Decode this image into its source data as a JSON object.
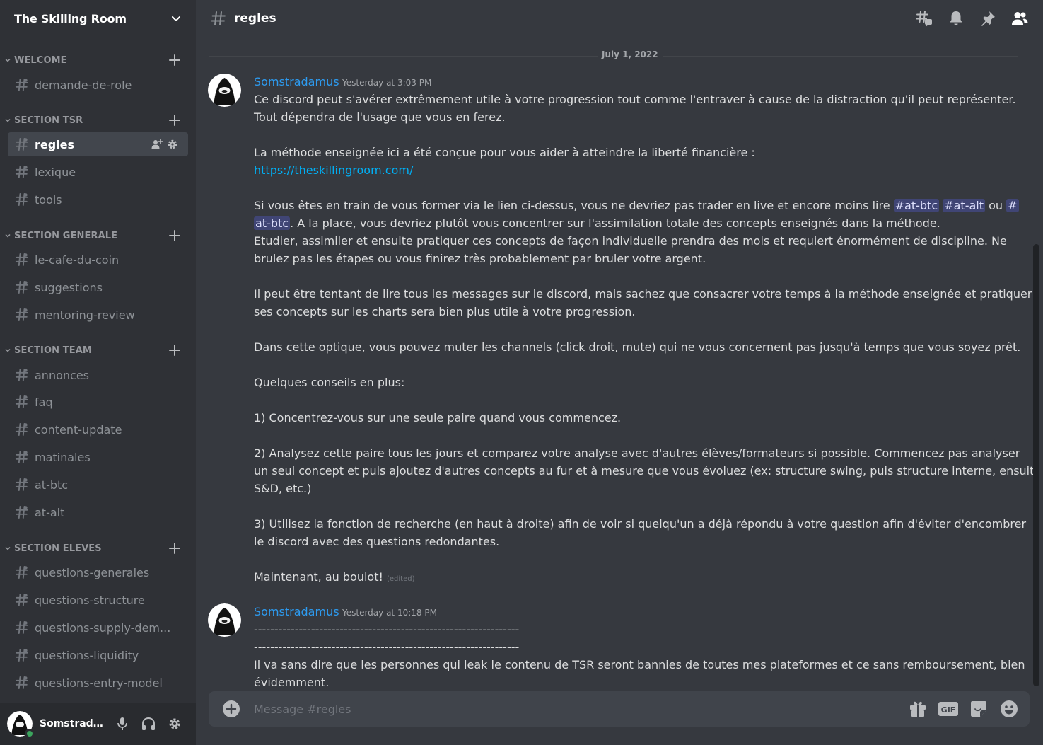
{
  "server": {
    "name": "The Skilling Room"
  },
  "categories": [
    {
      "label": "WELCOME",
      "channels": [
        "demande-de-role"
      ]
    },
    {
      "label": "SECTION TSR",
      "channels": [
        "regles",
        "lexique",
        "tools"
      ]
    },
    {
      "label": "SECTION GENERALE",
      "channels": [
        "le-cafe-du-coin",
        "suggestions",
        "mentoring-review"
      ]
    },
    {
      "label": "SECTION TEAM",
      "channels": [
        "annonces",
        "faq",
        "content-update",
        "matinales",
        "at-btc",
        "at-alt"
      ]
    },
    {
      "label": "SECTION ELEVES",
      "channels": [
        "questions-generales",
        "questions-structure",
        "questions-supply-dem...",
        "questions-liquidity",
        "questions-entry-model"
      ]
    }
  ],
  "active_channel": "regles",
  "user": {
    "name": "Somstrada...",
    "status": "online"
  },
  "header": {
    "channel_title": "regles",
    "icons": [
      "threads-icon",
      "bell-icon",
      "pin-icon",
      "members-icon"
    ]
  },
  "date_divider": "July 1, 2022",
  "messages": [
    {
      "author": "Somstradamus",
      "time": "Yesterday at 3:03 PM",
      "lines": {
        "l1": "Ce discord peut s'avérer extrêmement utile à votre progression tout comme l'entraver à cause de la distraction qu'il peut représenter.",
        "l2": "Tout dépendra de l'usage que vous en ferez.",
        "l3": "La méthode enseignée ici a été conçue pour vous aider à atteindre la liberté financière :",
        "link": "https://theskillingroom.com/",
        "l4a": "Si vous êtes en train de vous former via le lien ci-dessus, vous ne devriez pas trader en live et encore moins lire ",
        "mention1": "#at-btc",
        "mention2": "#at-alt",
        "l4b": " ou ",
        "mention3a": "#",
        "mention3b": "at-btc",
        "l5": ". A la place, vous devriez plutôt vous concentrer sur l'assimilation totale des concepts enseignés dans la méthode.",
        "l6": "Etudier, assimiler et ensuite pratiquer ces concepts de façon individuelle prendra des mois et requiert énormément de discipline. Ne",
        "l7": "brulez pas les étapes ou vous finirez très probablement par bruler votre argent.",
        "l8": "Il peut être tentant de lire tous les messages sur le discord, mais sachez que consacrer votre temps à la méthode enseignée et pratiquer",
        "l9": "ses concepts sur les charts sera bien plus utile à votre progression.",
        "l10": "Dans cette optique, vous pouvez muter les channels (click droit, mute) qui ne vous concernent pas jusqu'à temps que vous soyez prêt.",
        "l11": "Quelques conseils en plus:",
        "l12": "1) Concentrez-vous sur une seule paire quand vous commencez.",
        "l13": "2) Analysez cette paire tous les jours et comparez votre analyse avec d'autres élèves/formateurs si possible. Commencez pas analyser",
        "l14": "un seul concept et puis ajoutez d'autres concepts au fur et à mesure que vous évoluez (ex: structure swing, puis structure interne, ensuite",
        "l15": "S&D, etc.)",
        "l16": "3) Utilisez la fonction de recherche (en haut à droite) afin de voir si quelqu'un a déjà répondu à votre question afin d'éviter d'encombrer",
        "l17": "le discord avec des questions redondantes.",
        "l18": "Maintenant, au boulot! ",
        "edited": "(edited)"
      }
    },
    {
      "author": "Somstradamus",
      "time": "Yesterday at 10:18 PM",
      "lines": {
        "d1": "-----------------------------------------------------------------",
        "d2": "-----------------------------------------------------------------",
        "l1": "Il va sans dire que les personnes qui leak le contenu de TSR seront bannies de toutes mes plateformes et ce sans remboursement, bien",
        "l2": "évidemment."
      }
    }
  ],
  "composer": {
    "placeholder": "Message #regles",
    "icons": [
      "gift-icon",
      "gif-icon",
      "sticker-icon",
      "emoji-icon"
    ],
    "gif_label": "GIF"
  },
  "colors": {
    "accent_link": "#00aff4",
    "author": "#2d9bf0",
    "status_online": "#3ba55d"
  }
}
